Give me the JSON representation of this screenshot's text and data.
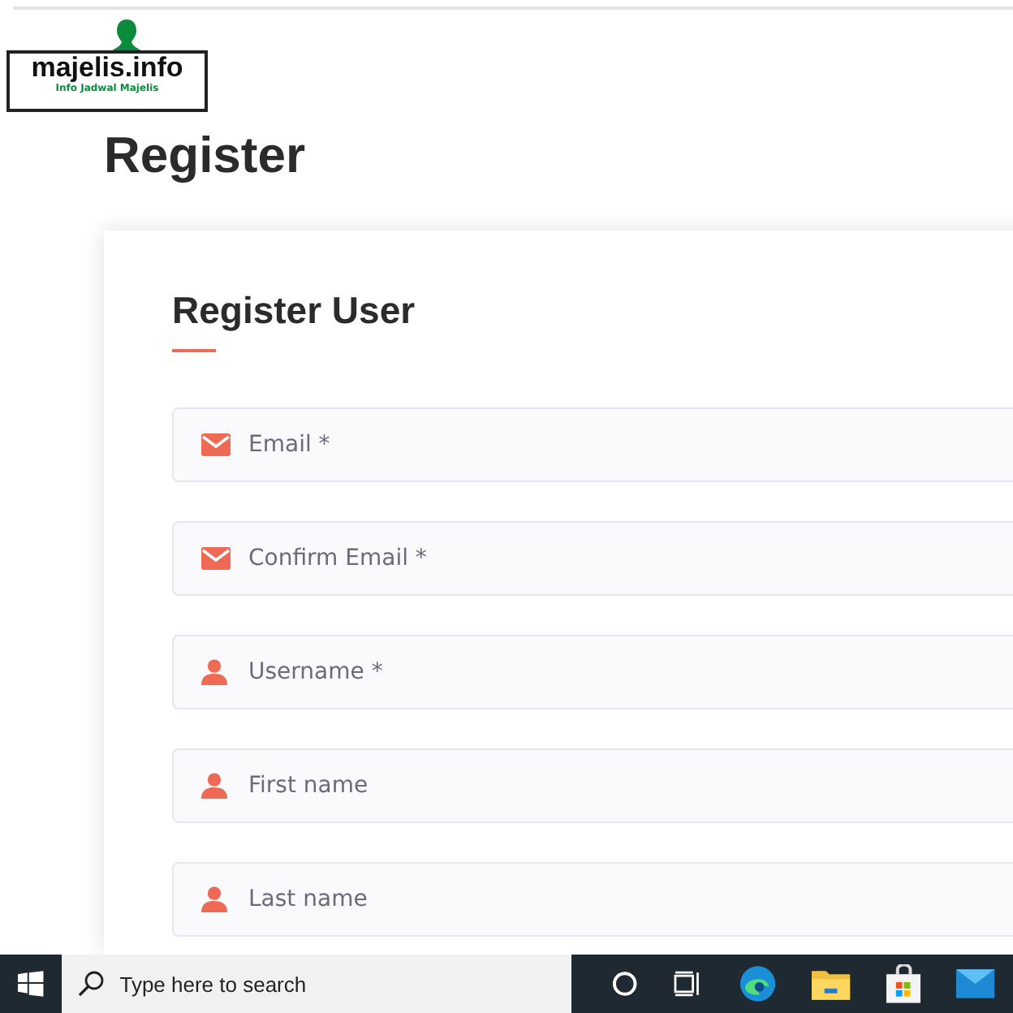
{
  "logo": {
    "name": "majelis.info",
    "tagline": "Info Jadwal Majelis"
  },
  "page_title": "Register",
  "card": {
    "title": "Register User",
    "fields": [
      {
        "kind": "email",
        "placeholder": "Email *"
      },
      {
        "kind": "email",
        "placeholder": "Confirm Email *"
      },
      {
        "kind": "user",
        "placeholder": "Username *"
      },
      {
        "kind": "user",
        "placeholder": "First name"
      },
      {
        "kind": "user",
        "placeholder": "Last name"
      }
    ]
  },
  "taskbar": {
    "search_placeholder": "Type here to search"
  }
}
